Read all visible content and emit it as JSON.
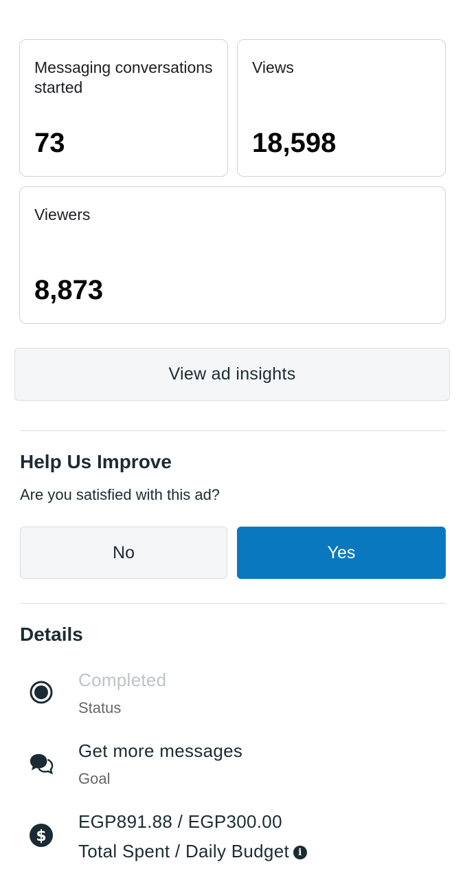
{
  "metrics": [
    {
      "label": "Messaging conversations started",
      "value": "73"
    },
    {
      "label": "Views",
      "value": "18,598"
    },
    {
      "label": "Viewers",
      "value": "8,873"
    }
  ],
  "insights_button": "View ad insights",
  "feedback": {
    "title": "Help Us Improve",
    "question": "Are you satisfied with this ad?",
    "no_label": "No",
    "yes_label": "Yes"
  },
  "details": {
    "title": "Details",
    "status": {
      "value": "Completed",
      "label": "Status",
      "icon": "status-radio-icon"
    },
    "goal": {
      "value": "Get more messages",
      "label": "Goal",
      "icon": "chat-bubbles-icon"
    },
    "budget": {
      "value": "EGP891.88 / EGP300.00",
      "label": "Total Spent / Daily Budget",
      "icon": "dollar-circle-icon"
    }
  },
  "colors": {
    "primary": "#0a78be",
    "text": "#1c2b33",
    "muted": "#65676b",
    "disabled": "#bec3c9"
  }
}
